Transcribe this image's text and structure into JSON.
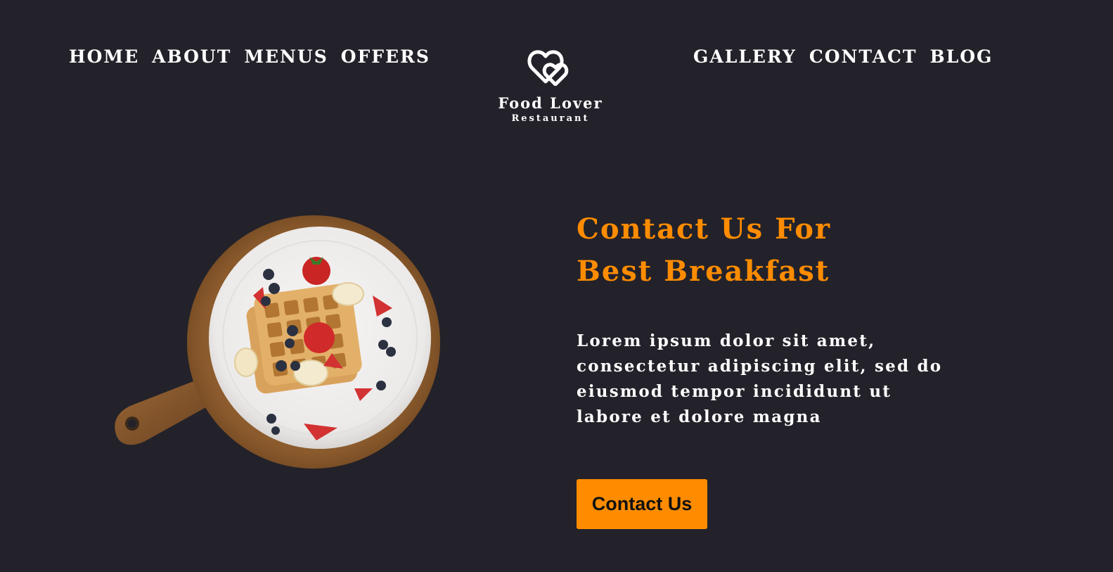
{
  "nav_left": [
    "HOME",
    "ABOUT",
    "MENUS",
    "OFFERS"
  ],
  "nav_right": [
    "GALLERY",
    "CONTACT",
    "BLOG"
  ],
  "logo": {
    "name": "Food Lover",
    "subtitle": "Restaurant",
    "icon": "double-heart-icon"
  },
  "hero": {
    "image": "waffle-plate-image",
    "heading_line1": "Contact Us For",
    "heading_line2": "Best Breakfast",
    "body": "Lorem ipsum dolor sit amet, consectetur adipiscing elit, sed do eiusmod tempor incididunt ut labore et dolore magna",
    "cta_label": "Contact Us"
  },
  "colors": {
    "background": "#23222a",
    "accent": "#ff8c00",
    "text": "#ffffff"
  }
}
